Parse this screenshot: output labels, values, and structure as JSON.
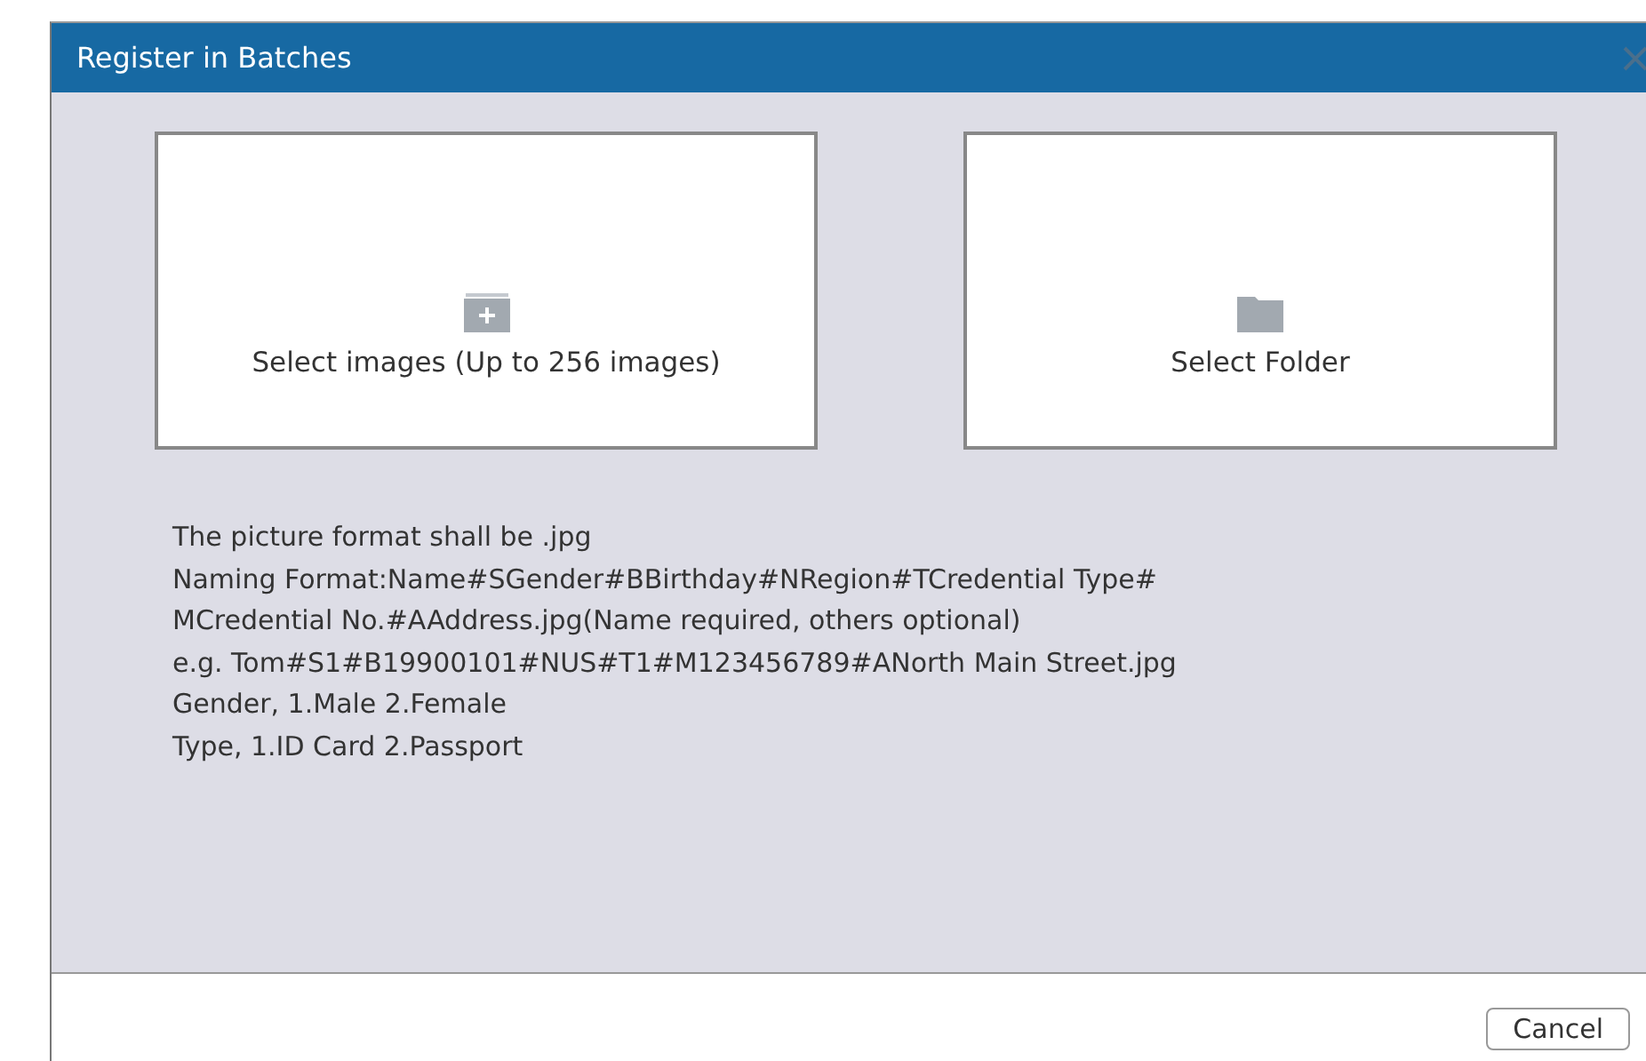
{
  "dialog": {
    "title": "Register in Batches",
    "options": [
      {
        "kind": "images",
        "label": "Select images (Up to 256 images)"
      },
      {
        "kind": "folder",
        "label": "Select Folder"
      }
    ],
    "instructions": [
      "The picture format shall be .jpg",
      " Naming Format:Name#SGender#BBirthday#NRegion#TCredential Type#",
      "MCredential No.#AAddress.jpg(Name required, others optional)",
      "e.g. Tom#S1#B19900101#NUS#T1#M123456789#ANorth Main Street.jpg",
      "Gender, 1.Male 2.Female",
      "Type, 1.ID Card 2.Passport"
    ],
    "buttons": [
      "Cancel"
    ]
  }
}
